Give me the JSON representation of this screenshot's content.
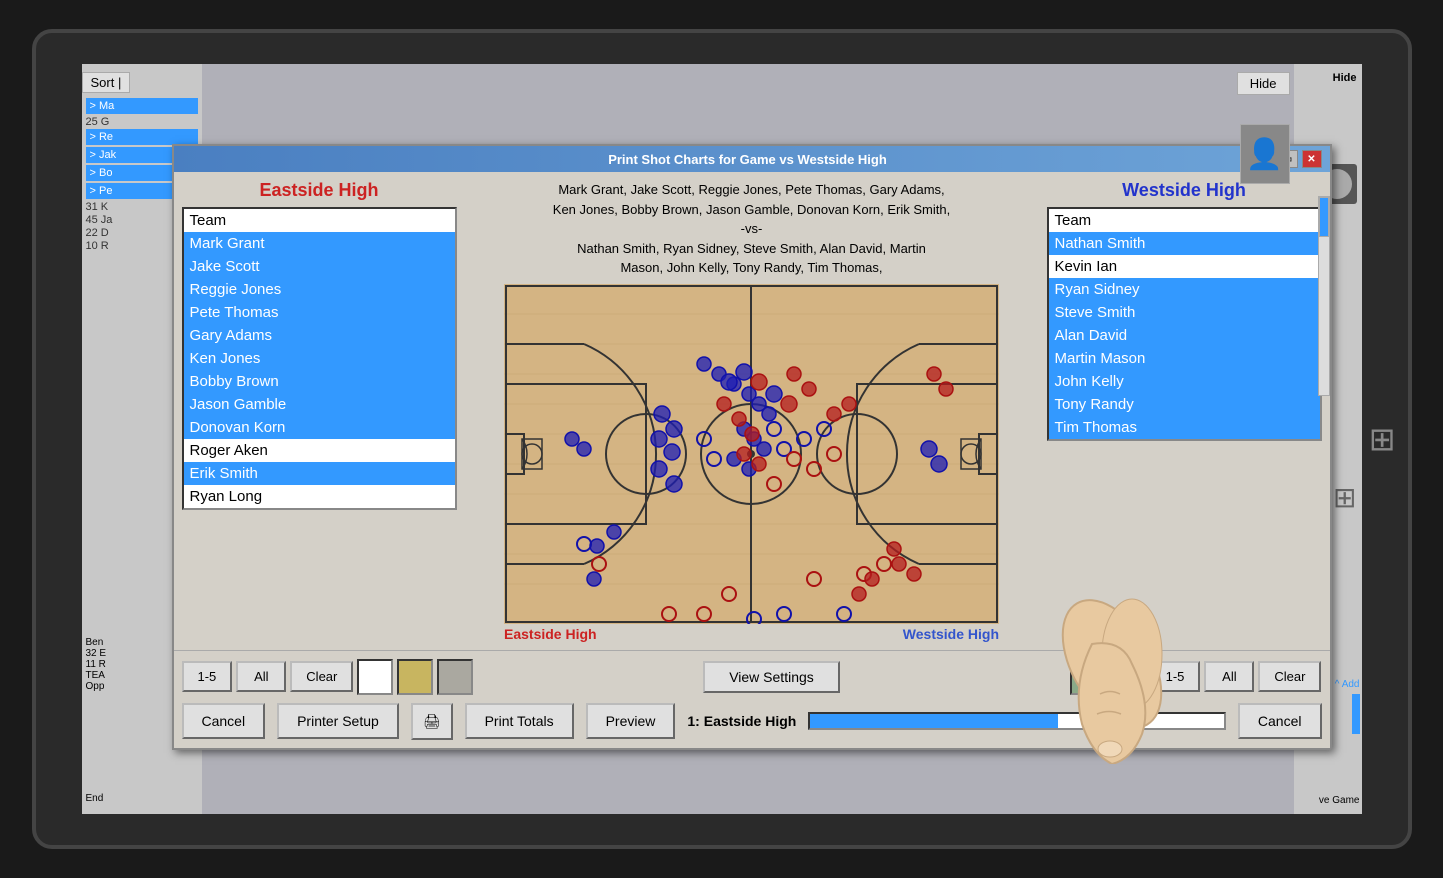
{
  "window": {
    "title": "Print Shot Charts for Game vs Westside High",
    "titlebar_controls": [
      "minimize",
      "restore",
      "close"
    ]
  },
  "sort_label": "Sort |",
  "hide_label": "Hide",
  "east_team": {
    "name": "Eastside High",
    "players": [
      {
        "name": "Team",
        "selected": false,
        "header": true
      },
      {
        "name": "Mark Grant",
        "selected": true
      },
      {
        "name": "Jake Scott",
        "selected": true
      },
      {
        "name": "Reggie Jones",
        "selected": true
      },
      {
        "name": "Pete Thomas",
        "selected": true
      },
      {
        "name": "Gary Adams",
        "selected": true
      },
      {
        "name": "Ken Jones",
        "selected": true
      },
      {
        "name": "Bobby Brown",
        "selected": true
      },
      {
        "name": "Jason Gamble",
        "selected": true
      },
      {
        "name": "Donovan Korn",
        "selected": true
      },
      {
        "name": "Roger Aken",
        "selected": false
      },
      {
        "name": "Erik Smith",
        "selected": true
      },
      {
        "name": "Ryan Long",
        "selected": false
      }
    ]
  },
  "west_team": {
    "name": "Westside High",
    "players": [
      {
        "name": "Team",
        "selected": false,
        "header": true
      },
      {
        "name": "Nathan Smith",
        "selected": true
      },
      {
        "name": "Kevin Ian",
        "selected": false
      },
      {
        "name": "Ryan Sidney",
        "selected": true
      },
      {
        "name": "Steve Smith",
        "selected": true
      },
      {
        "name": "Alan David",
        "selected": true
      },
      {
        "name": "Martin Mason",
        "selected": true
      },
      {
        "name": "John Kelly",
        "selected": true
      },
      {
        "name": "Tony Randy",
        "selected": true
      },
      {
        "name": "Tim Thomas",
        "selected": true
      }
    ]
  },
  "matchup_text_line1": "Mark Grant, Jake Scott, Reggie Jones, Pete Thomas, Gary Adams,",
  "matchup_text_line2": "Ken Jones, Bobby Brown, Jason Gamble, Donovan Korn, Erik Smith,",
  "matchup_text_vs": "-vs-",
  "matchup_text_line3": "Nathan Smith, Ryan Sidney, Steve Smith, Alan David, Martin",
  "matchup_text_line4": "Mason, John Kelly, Tony Randy, Tim Thomas,",
  "court_label_east": "Eastside High",
  "court_label_west": "Westside High",
  "controls": {
    "left_1_5": "1-5",
    "left_all": "All",
    "left_clear": "Clear",
    "view_settings": "View Settings",
    "right_1_5": "1-5",
    "right_all": "All",
    "right_clear": "Clear",
    "cancel": "Cancel",
    "printer_setup": "Printer Setup",
    "print_totals": "Print Totals",
    "preview": "Preview",
    "status": "1: Eastside High",
    "cancel2": "Cancel"
  },
  "colors": {
    "east_name": "#cc2222",
    "west_name": "#2233cc",
    "selected_bg": "#3399ff",
    "titlebar_start": "#4a7fc1",
    "shot_east_made": "#1111aa",
    "shot_east_miss": "#1111aa",
    "shot_west_made": "#aa1111",
    "shot_west_miss": "#aa1111"
  },
  "color_boxes_left": [
    "#ffffff",
    "#c8b560",
    "#aaa8a0"
  ],
  "color_boxes_right": [
    "#8aaa88",
    "#c8b560",
    "#ffffff"
  ]
}
